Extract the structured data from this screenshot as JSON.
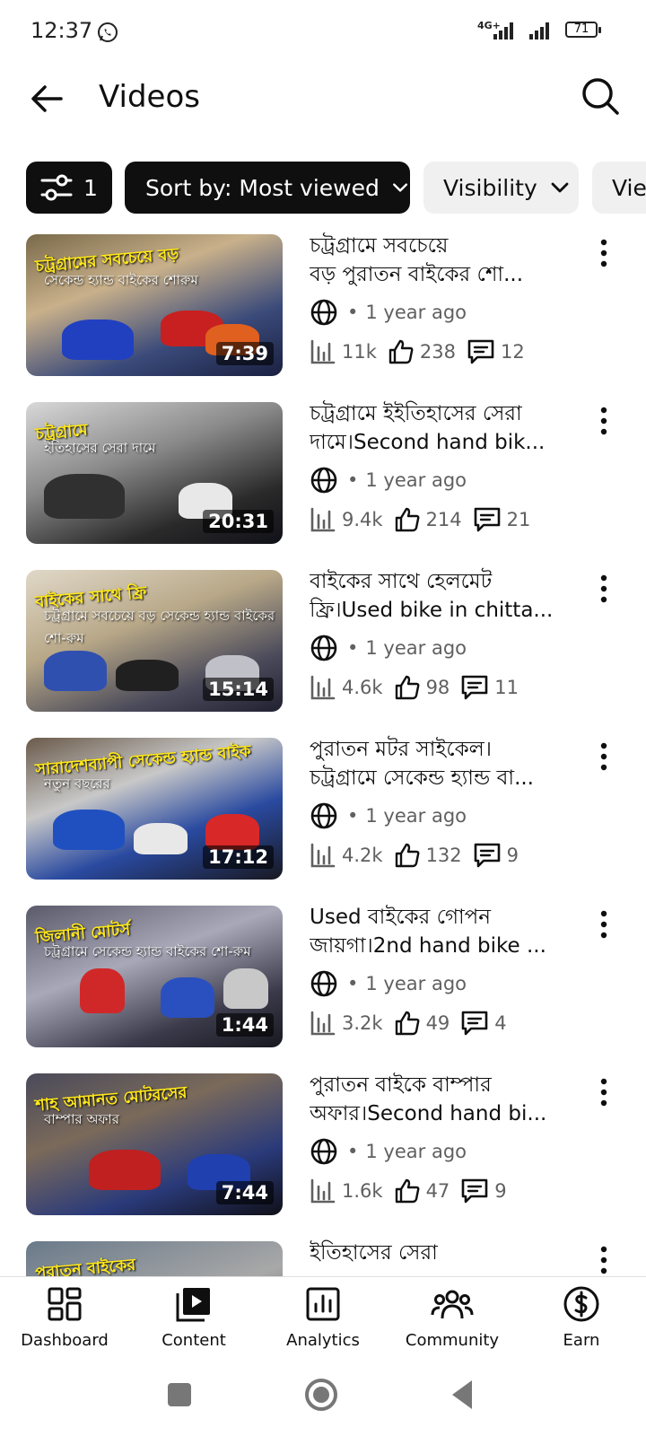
{
  "status_bar": {
    "time": "12:37",
    "network": "4G+",
    "battery": "71"
  },
  "header": {
    "title": "Videos"
  },
  "filters": {
    "filter_count": "1",
    "sort_label": "Sort by: Most viewed",
    "visibility_label": "Visibility",
    "views_label": "Vie"
  },
  "videos": [
    {
      "title_line1": "চট্রগ্রামে সবচেয়ে",
      "title_line2": "বড় পুরাতন বাইকের শো...",
      "visibility": "1 year ago",
      "views": "11k",
      "likes": "238",
      "comments": "12",
      "duration": "7:39",
      "thumb_text": "চট্রগ্রামের সবচেয়ে বড়",
      "thumb_sub": "সেকেন্ড হ্যান্ড বাইকের শোরুম"
    },
    {
      "title_line1": "চট্রগ্রামে ইইতিহাসের সেরা",
      "title_line2": "দামে।Second hand bik...",
      "visibility": "1 year ago",
      "views": "9.4k",
      "likes": "214",
      "comments": "21",
      "duration": "20:31",
      "thumb_text": "চট্রগ্রামে",
      "thumb_sub": "ইতিহাসের সেরা দামে"
    },
    {
      "title_line1": "বাইকের সাথে হেলমেট",
      "title_line2": "ফ্রি।Used bike in chitta...",
      "visibility": "1 year ago",
      "views": "4.6k",
      "likes": "98",
      "comments": "11",
      "duration": "15:14",
      "thumb_text": "বাইকের সাথে ফ্রি",
      "thumb_sub": "চট্রগ্রামে সবচেয়ে বড় সেকেন্ড হ্যান্ড বাইকের শো-রুম"
    },
    {
      "title_line1": "পুরাতন মটর সাইকেল।",
      "title_line2": "চট্রগ্রামে সেকেন্ড হ্যান্ড বা...",
      "visibility": "1 year ago",
      "views": "4.2k",
      "likes": "132",
      "comments": "9",
      "duration": "17:12",
      "thumb_text": "সারাদেশব্যাপী সেকেন্ড হ্যান্ড বাইক",
      "thumb_sub": "নতুন বছরের"
    },
    {
      "title_line1": "Used বাইকের গোপন",
      "title_line2": "জায়গা।2nd hand bike ...",
      "visibility": "1 year ago",
      "views": "3.2k",
      "likes": "49",
      "comments": "4",
      "duration": "1:44",
      "thumb_text": "জিলানী মোটর্স",
      "thumb_sub": "চট্রগ্রামে সেকেন্ড হ্যান্ড বাইকের শো-রুম"
    },
    {
      "title_line1": "পুরাতন বাইকে বাম্পার",
      "title_line2": "অফার।Second hand bi...",
      "visibility": "1 year ago",
      "views": "1.6k",
      "likes": "47",
      "comments": "9",
      "duration": "7:44",
      "thumb_text": "শাহ আমানত মোটরসের",
      "thumb_sub": "বাম্পার অফার"
    },
    {
      "title_line1": "ইতিহাসের সেরা",
      "title_line2": "",
      "visibility": "",
      "views": "",
      "likes": "",
      "comments": "",
      "duration": "",
      "thumb_text": "পুরাতন বাইকের",
      "thumb_sub": ""
    }
  ],
  "bottom_nav": [
    {
      "label": "Dashboard",
      "icon": "dashboard-icon"
    },
    {
      "label": "Content",
      "icon": "content-icon"
    },
    {
      "label": "Analytics",
      "icon": "analytics-icon"
    },
    {
      "label": "Community",
      "icon": "community-icon"
    },
    {
      "label": "Earn",
      "icon": "earn-icon"
    }
  ],
  "colors": {
    "chip_dark": "#0f0f0f",
    "chip_light": "#f0f0f0",
    "meta_gray": "#606060"
  }
}
